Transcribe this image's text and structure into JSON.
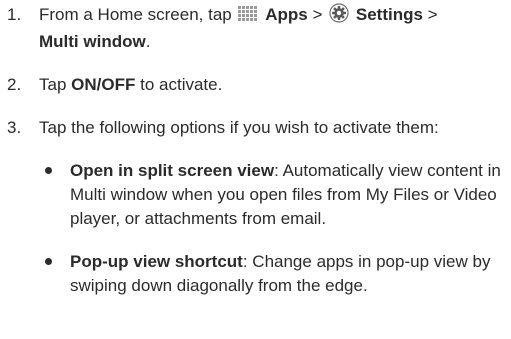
{
  "steps": [
    {
      "number": "1.",
      "prefix": "From a Home screen, tap",
      "apps_icon": "apps-grid-icon",
      "apps_label": "Apps",
      "sep1": ">",
      "settings_icon": "settings-gear-icon",
      "settings_label": "Settings",
      "sep2": ">",
      "target_label": "Multi window",
      "end": "."
    },
    {
      "number": "2.",
      "prefix": "Tap",
      "bold": "ON/OFF",
      "suffix": "to activate."
    },
    {
      "number": "3.",
      "text": "Tap the following options if you wish to activate them:"
    }
  ],
  "options": [
    {
      "title": "Open in split screen view",
      "description": ": Automatically view content in Multi window when you open files from My Files or Video player, or attachments from email."
    },
    {
      "title": "Pop-up view shortcut",
      "description": ": Change apps in pop-up view by swiping down diagonally from the edge."
    }
  ],
  "colors": {
    "text": "#2b2b2b"
  }
}
